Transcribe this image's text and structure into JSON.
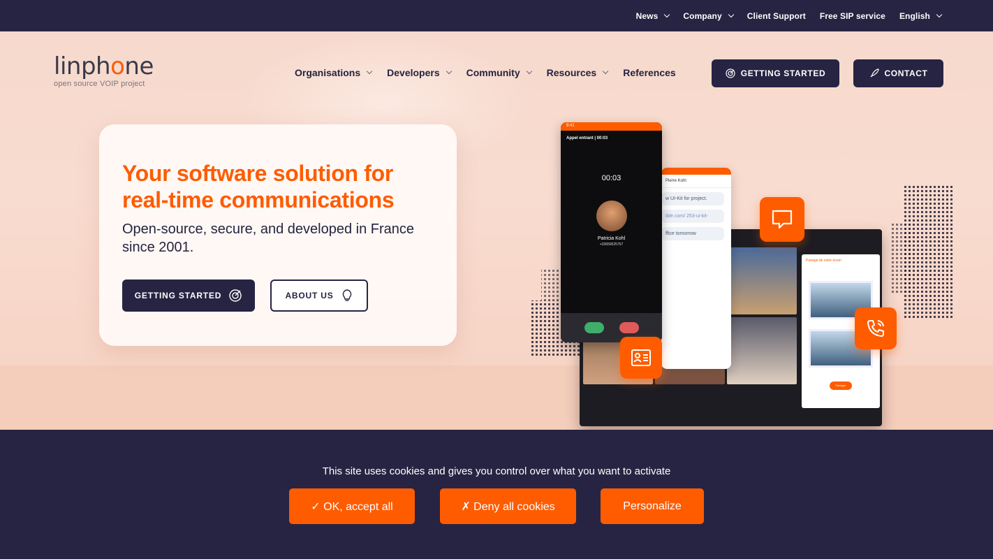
{
  "topbar": {
    "items": [
      {
        "label": "News",
        "dropdown": true
      },
      {
        "label": "Company",
        "dropdown": true
      },
      {
        "label": "Client Support",
        "dropdown": false
      },
      {
        "label": "Free SIP service",
        "dropdown": false
      },
      {
        "label": "English",
        "dropdown": true
      }
    ]
  },
  "logo": {
    "word_pre": "linph",
    "word_o": "o",
    "word_post": "ne",
    "tagline": "open source VOIP project"
  },
  "nav": {
    "items": [
      {
        "label": "Organisations",
        "dropdown": true
      },
      {
        "label": "Developers",
        "dropdown": true
      },
      {
        "label": "Community",
        "dropdown": true
      },
      {
        "label": "Resources",
        "dropdown": true
      },
      {
        "label": "References",
        "dropdown": false
      }
    ],
    "getting_started": "GETTING STARTED",
    "contact": "CONTACT"
  },
  "hero": {
    "title": "Your software solution for real-time communications",
    "subtitle": "Open-source, secure, and developed in France since 2001.",
    "cta_primary": "GETTING STARTED",
    "cta_secondary": "ABOUT US"
  },
  "illustration": {
    "phone_time": "9:41",
    "phone_title": "Appel entrant | 00:03",
    "call_timer": "00:03",
    "caller_name": "Patricia Kohl",
    "caller_number": "+33650025757",
    "chat_contact": "Pierre Kohl",
    "chat_msg1": "w UI-Kit for project.",
    "chat_msg2": "ible.com/ 253-ui-kit-",
    "chat_msg3": "ffice tomorrow",
    "panel_title": "Partage de votre écran",
    "panel_button": "Partager"
  },
  "cookie": {
    "text": "This site uses cookies and gives you control over what you want to activate",
    "accept": "✓ OK, accept all",
    "deny": "✗ Deny all cookies",
    "personalize": "Personalize"
  },
  "colors": {
    "accent": "#ff5c00",
    "dark": "#272342",
    "hero_bg": "#f7d9cd"
  }
}
